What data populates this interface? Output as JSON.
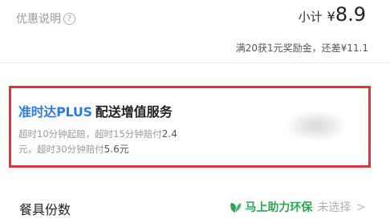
{
  "discount": {
    "label": "优惠说明",
    "help_glyph": "?"
  },
  "subtotal": {
    "label": "小计",
    "currency": "¥",
    "amount": "8.9"
  },
  "reward_note": "满20获1元奖励金，还差¥11.1",
  "service": {
    "brand": "准时达PLUS",
    "name": "配送增值服务",
    "rules": {
      "line1_prefix": "超时10分钟起赔，超时15分钟赔付",
      "line1_amount": "2.4",
      "line2_unit": "元",
      "line2_middle": "，超时30分钟赔付",
      "line2_amount": "5.6元"
    },
    "highlight_color": "#dd3636",
    "brand_color": "#2b7de1"
  },
  "utensils": {
    "label": "餐具份数",
    "eco_label": "马上助力环保",
    "status": "未选择",
    "eco_icon": "leaf-icon",
    "eco_color": "#2fa550"
  }
}
